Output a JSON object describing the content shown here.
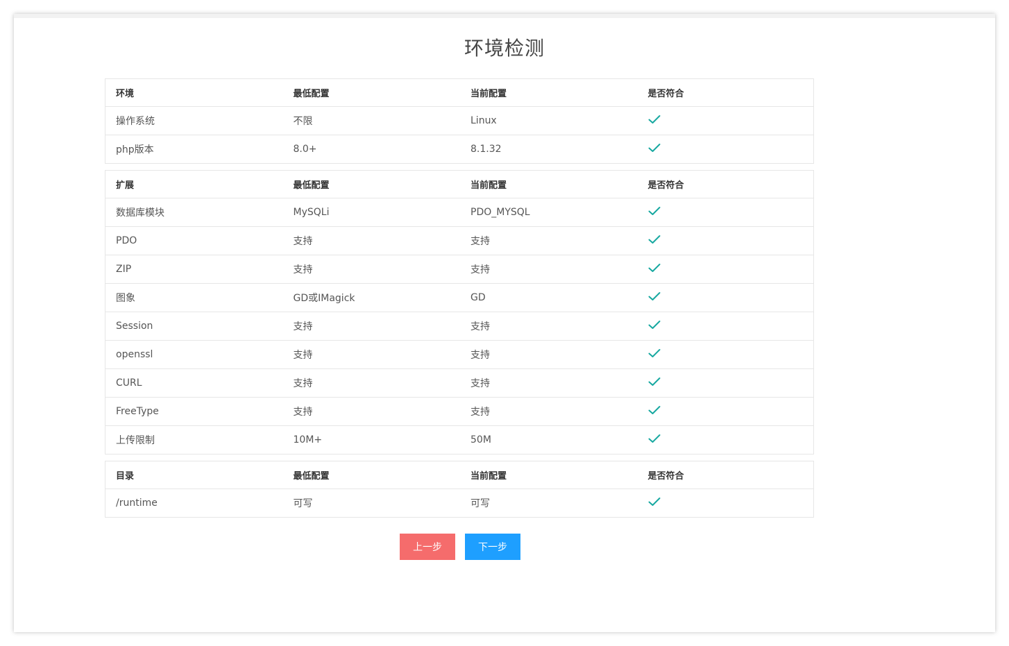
{
  "page": {
    "title": "环境检测"
  },
  "tables": [
    {
      "headers": [
        "环境",
        "最低配置",
        "当前配置",
        "是否符合"
      ],
      "rows": [
        [
          "操作系统",
          "不限",
          "Linux"
        ],
        [
          "php版本",
          "8.0+",
          "8.1.32"
        ]
      ]
    },
    {
      "headers": [
        "扩展",
        "最低配置",
        "当前配置",
        "是否符合"
      ],
      "rows": [
        [
          "数据库模块",
          "MySQLi",
          "PDO_MYSQL"
        ],
        [
          "PDO",
          "支持",
          "支持"
        ],
        [
          "ZIP",
          "支持",
          "支持"
        ],
        [
          "图象",
          "GD或IMagick",
          "GD"
        ],
        [
          "Session",
          "支持",
          "支持"
        ],
        [
          "openssl",
          "支持",
          "支持"
        ],
        [
          "CURL",
          "支持",
          "支持"
        ],
        [
          "FreeType",
          "支持",
          "支持"
        ],
        [
          "上传限制",
          "10M+",
          "50M"
        ]
      ]
    },
    {
      "headers": [
        "目录",
        "最低配置",
        "当前配置",
        "是否符合"
      ],
      "rows": [
        [
          "/runtime",
          "可写",
          "可写"
        ]
      ]
    }
  ],
  "status_icon": "check-icon",
  "colors": {
    "check": "#16a8a0",
    "prev_button": "#f56c6c",
    "next_button": "#1e9fff"
  },
  "buttons": {
    "prev_label": "上一步",
    "next_label": "下一步"
  }
}
